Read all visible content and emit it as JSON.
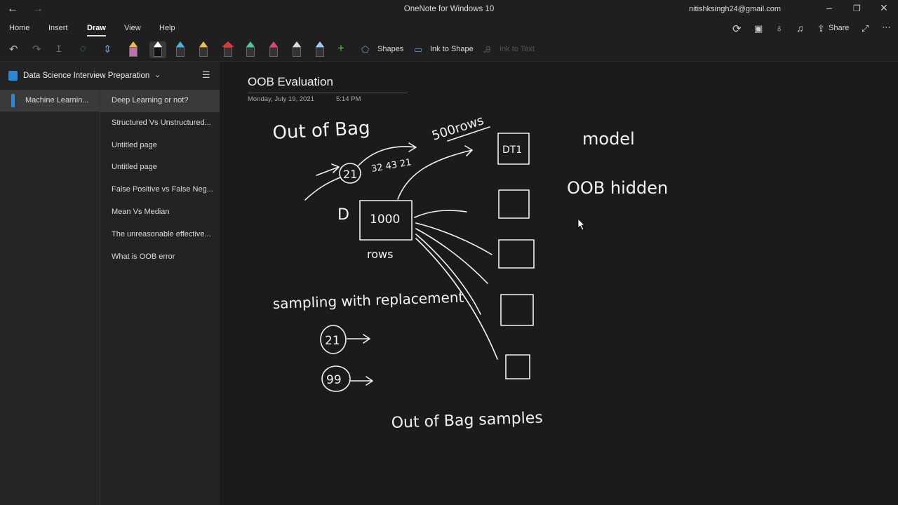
{
  "window": {
    "title": "OneNote for Windows 10",
    "account": "nitishksingh24@gmail.com"
  },
  "ribbon": {
    "tabs": [
      "Home",
      "Insert",
      "Draw",
      "View",
      "Help"
    ],
    "active_tab": "Draw",
    "share_label": "Share"
  },
  "toolbar": {
    "shapes_label": "Shapes",
    "ink_to_shape_label": "Ink to Shape",
    "ink_to_text_label": "Ink to Text",
    "pen_colors": [
      "#e8a0d0",
      "#ffffff",
      "#3fb8e8",
      "#f0c040",
      "#e83030",
      "#40d090",
      "#e84080",
      "#c0c0c0",
      "#9fc8ff"
    ]
  },
  "notebook": {
    "title": "Data Science Interview Preparation",
    "section": "Machine Learnin...",
    "pages": [
      "Deep Learning or not?",
      "Structured Vs Unstructured...",
      "Untitled page",
      "Untitled page",
      "False Positive vs False Neg...",
      "Mean Vs Median",
      "The unreasonable effective...",
      "What is OOB error"
    ]
  },
  "page": {
    "title": "OOB Evaluation",
    "date": "Monday, July 19, 2021",
    "time": "5:14 PM"
  },
  "ink": {
    "out_of_bag": "Out of Bag",
    "rows_500": "500rows",
    "dt1": "DT1",
    "model": "model",
    "oob_hidden": "OOB hidden",
    "d_label": "D",
    "box_1000": "1000",
    "rows": "rows",
    "circle_21": "21",
    "nums": "32  43 21",
    "sampling": "sampling with replacement",
    "circle_21b": "21",
    "circle_99": "99",
    "oob_samples": "Out of Bag samples"
  }
}
